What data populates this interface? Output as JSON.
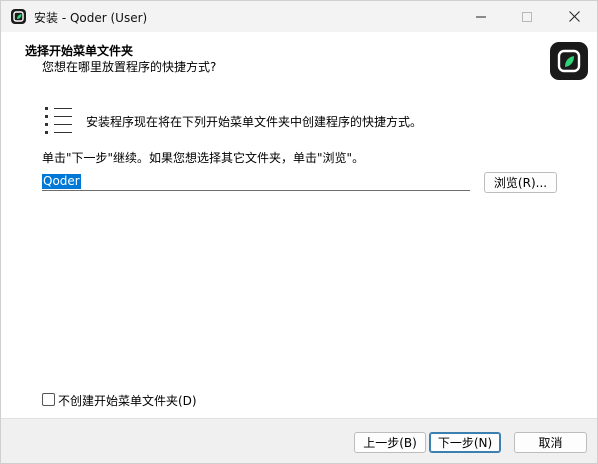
{
  "window": {
    "title": "安装 - Qoder (User)",
    "icon": "qoder-app-icon",
    "controls": {
      "minimize": "minimize-icon",
      "maximize": "maximize-icon",
      "close": "close-icon"
    }
  },
  "header": {
    "title": "选择开始菜单文件夹",
    "subtitle": "您想在哪里放置程序的快捷方式?",
    "logo": "qoder-logo"
  },
  "content": {
    "description": "安装程序现在将在下列开始菜单文件夹中创建程序的快捷方式。",
    "hint": "单击\"下一步\"继续。如果您想选择其它文件夹，单击\"浏览\"。",
    "folder_value": "Qoder",
    "browse_label": "浏览(R)...",
    "no_folder_checkbox_label": "不创建开始菜单文件夹(D)",
    "no_folder_checked": false
  },
  "footer": {
    "back_label": "上一步(B)",
    "next_label": "下一步(N)",
    "cancel_label": "取消"
  },
  "colors": {
    "selection": "#0078d7",
    "titlebar": "#f3f3f3",
    "footer": "#f0f0f0",
    "logo_bg": "#1a1a1a",
    "logo_leaf": "#2fd47a"
  }
}
